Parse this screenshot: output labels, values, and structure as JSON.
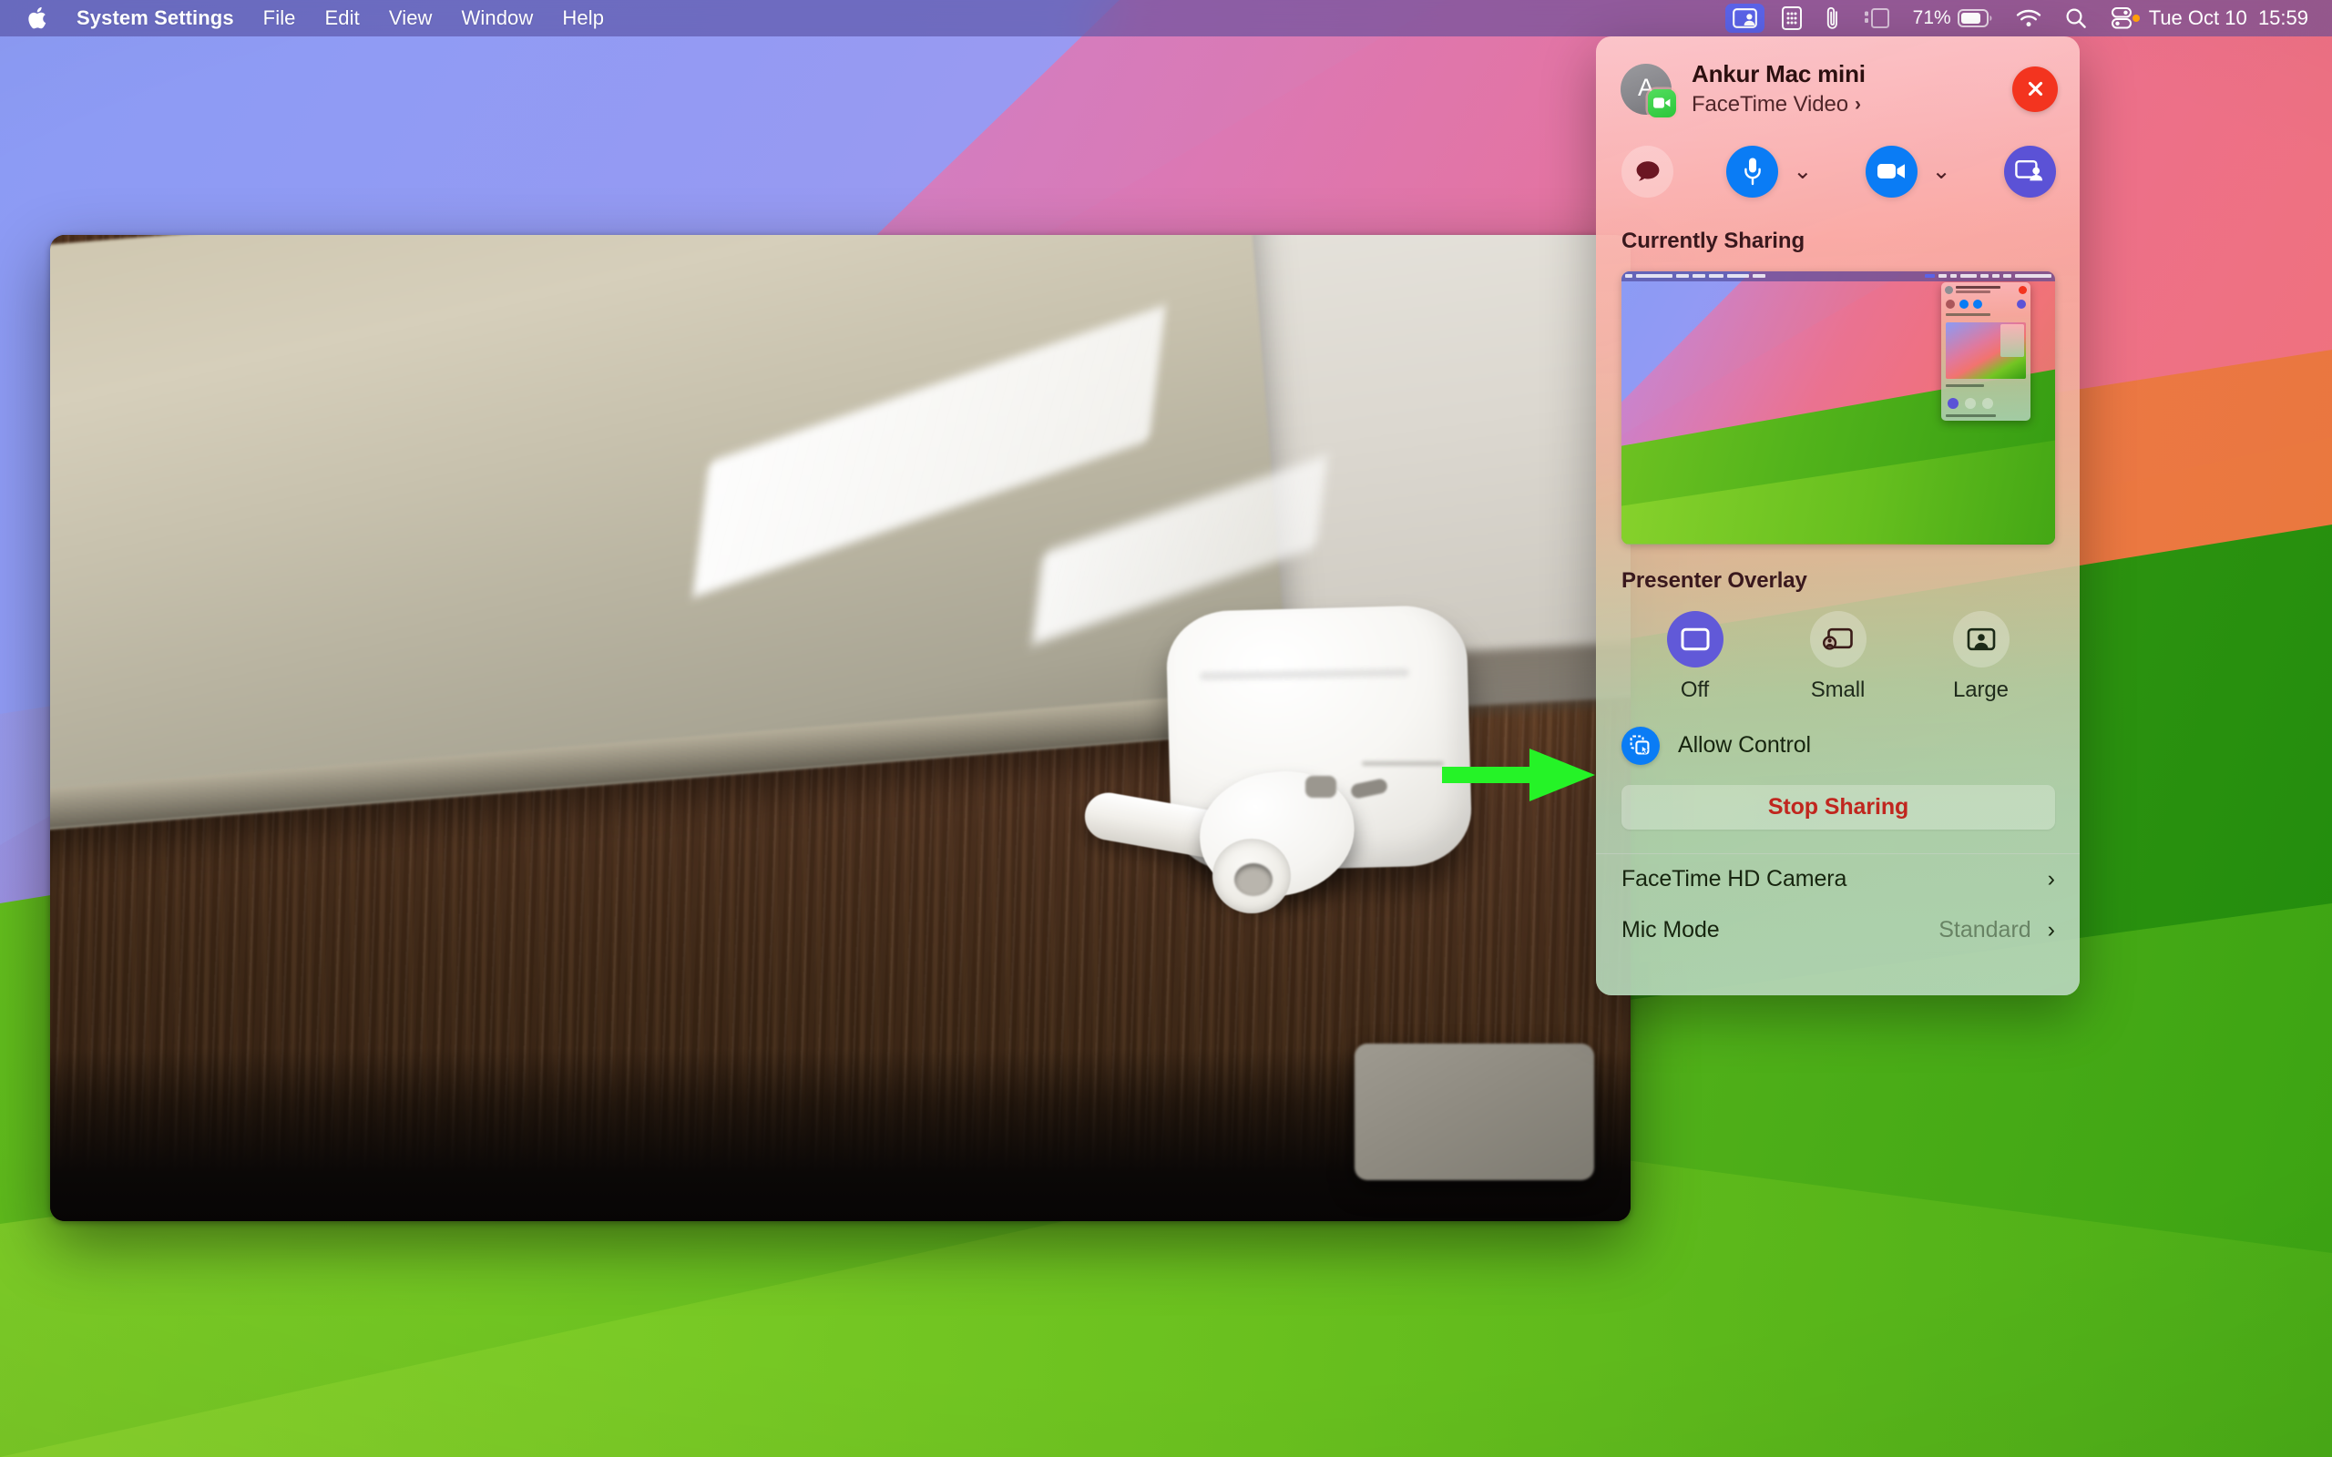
{
  "menubar": {
    "apple_icon": "apple-logo-icon",
    "items": [
      {
        "label": "System Settings",
        "bold": true
      },
      {
        "label": "File",
        "bold": false
      },
      {
        "label": "Edit",
        "bold": false
      },
      {
        "label": "View",
        "bold": false
      },
      {
        "label": "Window",
        "bold": false
      },
      {
        "label": "Help",
        "bold": false
      }
    ],
    "status": {
      "screenshare_icon": "screen-share-active-icon",
      "calculator_icon": "calculator-icon",
      "clipboard_icon": "paperclip-icon",
      "stage_manager_icon": "stage-manager-icon",
      "battery_percent": "71%",
      "battery_icon": "battery-icon",
      "wifi_icon": "wifi-icon",
      "search_icon": "spotlight-search-icon",
      "control_center_icon": "control-center-icon",
      "clock": "Tue Oct 10  15:59"
    }
  },
  "video_window": {
    "name": "facetime-video-window",
    "description": "Live FaceTime video feed showing AirPods Pro and case on a wooden desk next to a laptop",
    "pip": {
      "name": "self-view-pip",
      "description": "blurred self view thumbnail"
    }
  },
  "panel": {
    "header": {
      "avatar_letter": "A",
      "avatar_badge_icon": "facetime-video-badge-icon",
      "title": "Ankur Mac mini",
      "subtitle": "FaceTime Video",
      "subtitle_chevron": "›",
      "close_icon": "close-icon"
    },
    "controls": [
      {
        "name": "chat-button",
        "icon": "chat-bubble-icon",
        "style": "dim",
        "has_chevron": false
      },
      {
        "name": "microphone-button",
        "icon": "microphone-icon",
        "style": "blue",
        "has_chevron": true
      },
      {
        "name": "video-button",
        "icon": "video-camera-icon",
        "style": "blue",
        "has_chevron": true
      },
      {
        "name": "screen-share-button",
        "icon": "screen-share-icon",
        "style": "purple",
        "has_chevron": false
      }
    ],
    "currently_sharing": {
      "label": "Currently Sharing",
      "preview_description": "Screen preview of the shared desktop with the FaceTime panel visible"
    },
    "presenter_overlay": {
      "label": "Presenter Overlay",
      "options": [
        {
          "label": "Off",
          "icon": "overlay-off-icon",
          "selected": true
        },
        {
          "label": "Small",
          "icon": "overlay-small-icon",
          "selected": false
        },
        {
          "label": "Large",
          "icon": "overlay-large-icon",
          "selected": false
        }
      ]
    },
    "allow_control": {
      "label": "Allow Control",
      "icon": "allow-control-icon"
    },
    "stop_sharing": {
      "label": "Stop Sharing"
    },
    "footer_rows": [
      {
        "label": "FaceTime HD Camera",
        "value": "",
        "chevron": "›"
      },
      {
        "label": "Mic Mode",
        "value": "Standard",
        "chevron": "›"
      }
    ]
  },
  "annotation": {
    "arrow": {
      "name": "green-annotation-arrow",
      "color": "#25f327",
      "points_to": "allow-control-button"
    }
  },
  "colors": {
    "accent_blue": "#0a7cf5",
    "accent_purple": "#5b52d6",
    "close_red": "#f3341f",
    "stop_sharing_red": "#c0261e",
    "facetime_green": "#2cc63b",
    "annotation_green": "#25f327",
    "menubar_blue": "#5b63e8"
  }
}
